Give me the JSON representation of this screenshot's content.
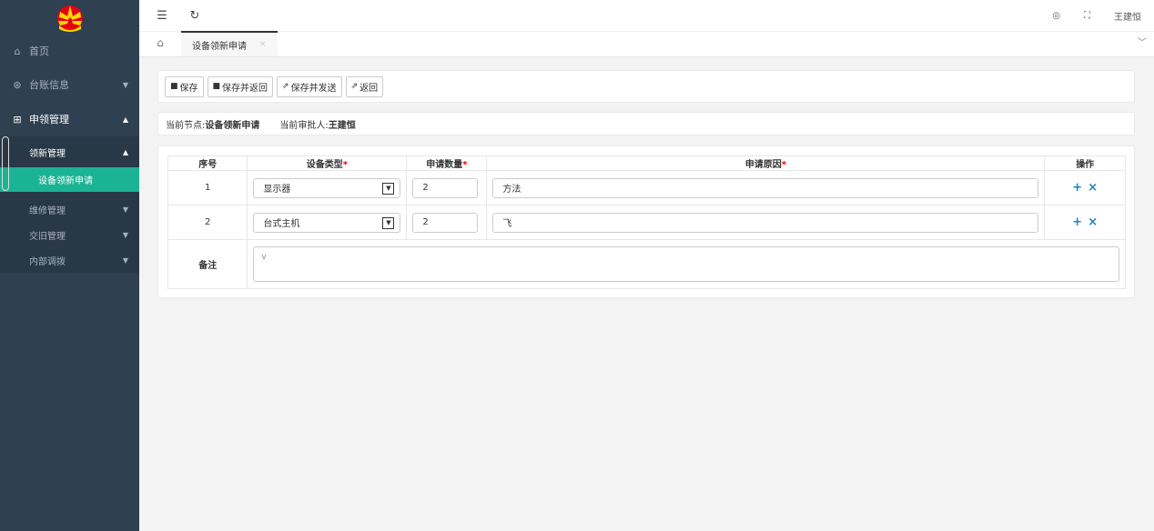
{
  "sidebar": {
    "items": [
      {
        "label": "首页",
        "icon": "home-icon"
      },
      {
        "label": "台账信息",
        "icon": "cube-icon"
      },
      {
        "label": "申领管理",
        "icon": "apps-icon"
      }
    ],
    "sub_items": [
      {
        "label": "领新管理"
      },
      {
        "label": "设备领新申请"
      },
      {
        "label": "维修管理"
      },
      {
        "label": "交旧管理"
      },
      {
        "label": "内部调拨"
      }
    ],
    "accent": "#1ab394",
    "background": "#2f4050"
  },
  "topbar": {
    "user": "王建恒"
  },
  "tabs": [
    {
      "label": "设备领新申请"
    }
  ],
  "toolbar": {
    "save": "保存",
    "save_return": "保存并返回",
    "save_send": "保存并发送",
    "back": "返回"
  },
  "info": {
    "node_label": "当前节点:",
    "node_value": "设备领新申请",
    "approver_label": "当前审批人:",
    "approver_value": "王建恒"
  },
  "table": {
    "headers": {
      "index": "序号",
      "type": "设备类型",
      "qty": "申请数量",
      "reason": "申请原因",
      "ops": "操作",
      "required_mark": "*"
    },
    "rows": [
      {
        "index": "1",
        "type": "显示器",
        "qty": "2",
        "reason": "方法"
      },
      {
        "index": "2",
        "type": "台式主机",
        "qty": "2",
        "reason": "飞"
      }
    ],
    "remark_label": "备注",
    "remark_value": "v"
  }
}
